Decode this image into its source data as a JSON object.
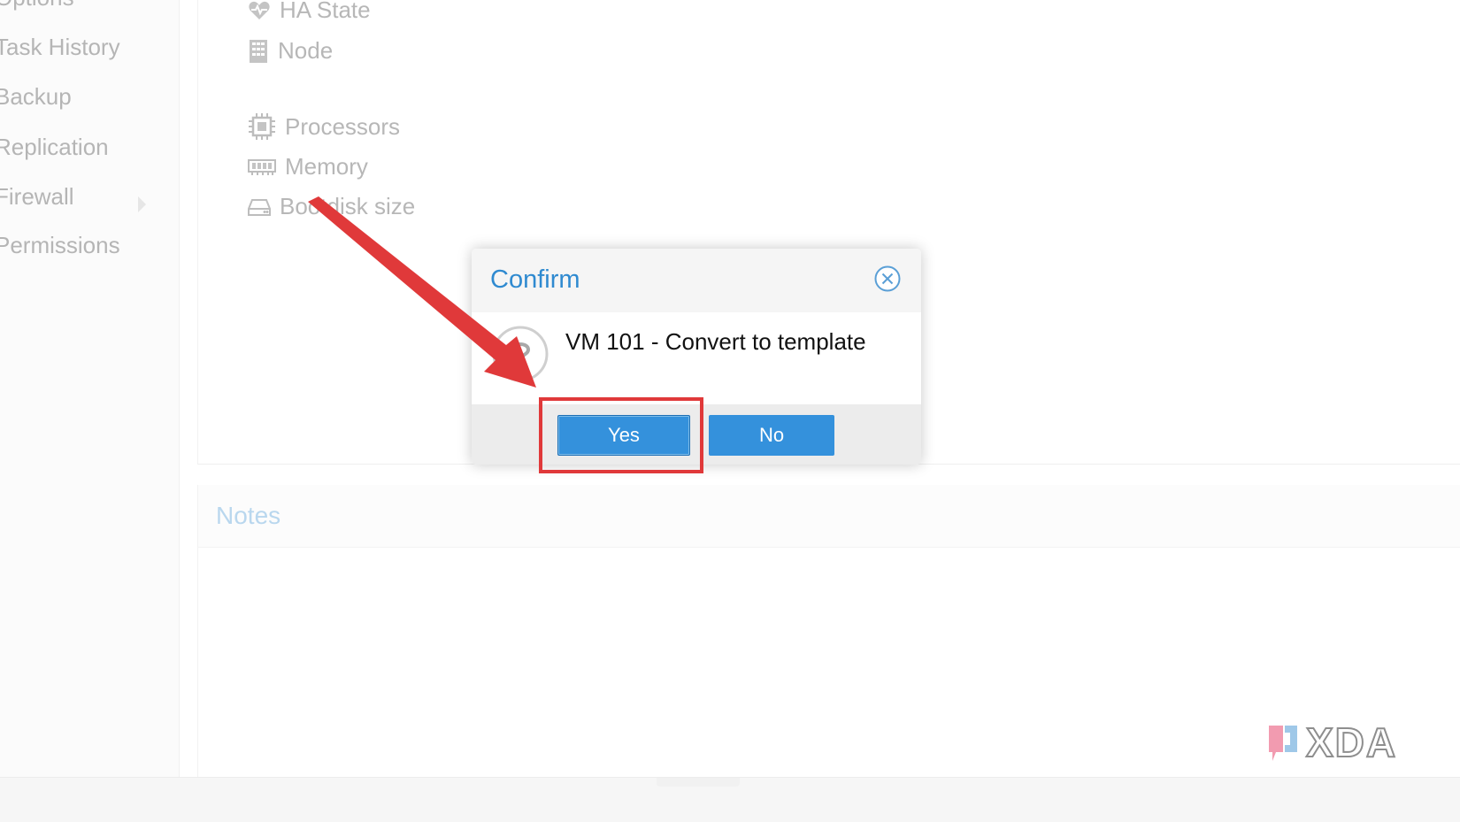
{
  "sidebar": {
    "items": [
      {
        "label": "Options"
      },
      {
        "label": "Task History"
      },
      {
        "label": "Backup"
      },
      {
        "label": "Replication"
      },
      {
        "label": "Firewall"
      },
      {
        "label": "Permissions"
      }
    ]
  },
  "summary": {
    "properties": [
      {
        "label": "HA State",
        "icon": "heartbeat-icon"
      },
      {
        "label": "Node",
        "icon": "building-icon"
      },
      {
        "label": "Processors",
        "icon": "cpu-icon"
      },
      {
        "label": "Memory",
        "icon": "memory-icon"
      },
      {
        "label": "Bootdisk size",
        "icon": "hdd-icon"
      }
    ]
  },
  "notes": {
    "title": "Notes"
  },
  "dialog": {
    "title": "Confirm",
    "message": "VM 101 - Convert to template",
    "yes_label": "Yes",
    "no_label": "No",
    "icon": "question-icon"
  },
  "watermark": {
    "text": "XDA"
  },
  "colors": {
    "accent": "#3491dc",
    "title": "#2f8ad0",
    "annotation": "#e0393a"
  }
}
